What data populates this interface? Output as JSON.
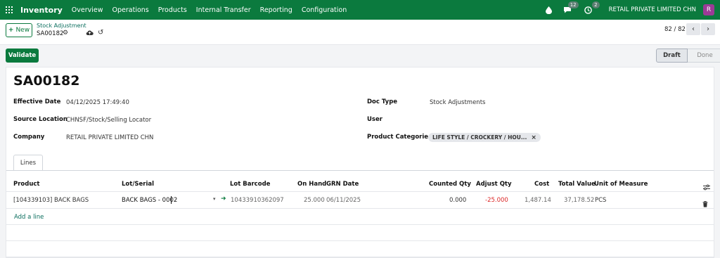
{
  "nav": {
    "app_title": "Inventory",
    "items": [
      "Overview",
      "Operations",
      "Products",
      "Internal Transfer",
      "Reporting",
      "Configuration"
    ],
    "chat_count": "12",
    "activity_count": "2",
    "company": "RETAIL PRIVATE LIMITED CHN",
    "avatar_initial": "R"
  },
  "control": {
    "new_label": "New",
    "breadcrumb_parent": "Stock Adjustment",
    "breadcrumb_current": "SA00182",
    "pager": "82 / 82"
  },
  "actions": {
    "validate_label": "Validate",
    "status_draft": "Draft",
    "status_done": "Done"
  },
  "record": {
    "name": "SA00182",
    "effective_date_label": "Effective Date",
    "effective_date": "04/12/2025 17:49:40",
    "source_location_label": "Source Location",
    "source_location": "CHNSF/Stock/Selling Locator",
    "company_label": "Company",
    "company": "RETAIL PRIVATE LIMITED CHN",
    "doc_type_label": "Doc Type",
    "doc_type": "Stock Adjustments",
    "user_label": "User",
    "product_categories_label": "Product Categories",
    "product_category_tag": "LIFE STYLE / CROCKERY / HOU..."
  },
  "lines": {
    "tab_label": "Lines",
    "headers": {
      "product": "Product",
      "lot_serial": "Lot/Serial",
      "lot_barcode": "Lot Barcode",
      "on_hand": "On Hand",
      "grn_date": "GRN Date",
      "counted_qty": "Counted Qty",
      "adjust_qty": "Adjust Qty",
      "cost": "Cost",
      "total_value": "Total Value",
      "uom": "Unit of Measure"
    },
    "row": {
      "product": "[104339103] BACK BAGS",
      "lot_serial": "BACK BAGS - 0002",
      "lot_barcode": "10433910362097",
      "on_hand": "25.000",
      "grn_date": "06/11/2025",
      "counted_qty": "0.000",
      "adjust_qty": "-25.000",
      "cost": "1,487.14",
      "total_value": "37,178.52",
      "uom": "PCS"
    },
    "add_line_label": "Add a line"
  },
  "colors": {
    "brand": "#0b7a3e",
    "negative": "#dc2626",
    "avatar": "#9b3b96"
  }
}
